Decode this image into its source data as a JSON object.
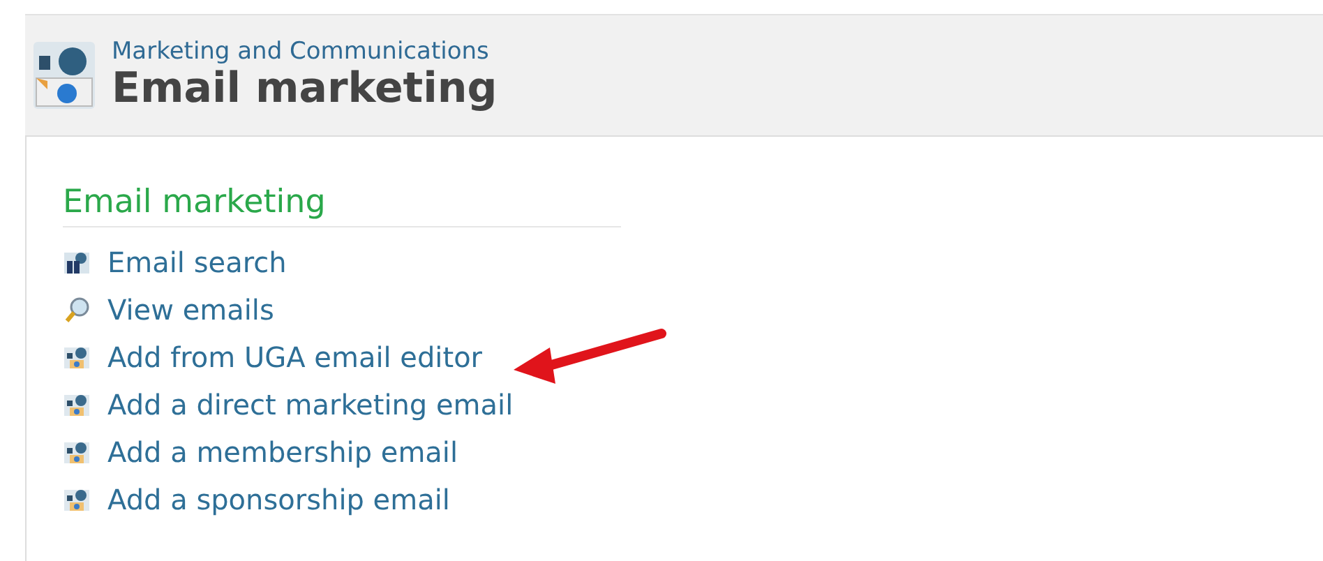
{
  "header": {
    "category": "Marketing and Communications",
    "title": "Email marketing"
  },
  "section": {
    "title": "Email marketing",
    "links": [
      {
        "label": "Email search",
        "kind": "search",
        "annotated": false
      },
      {
        "label": "View emails",
        "kind": "view",
        "annotated": false
      },
      {
        "label": "Add from UGA email editor",
        "kind": "add",
        "annotated": true
      },
      {
        "label": "Add a direct marketing email",
        "kind": "add",
        "annotated": false
      },
      {
        "label": "Add a membership email",
        "kind": "add",
        "annotated": false
      },
      {
        "label": "Add a sponsorship email",
        "kind": "add",
        "annotated": false
      }
    ]
  }
}
